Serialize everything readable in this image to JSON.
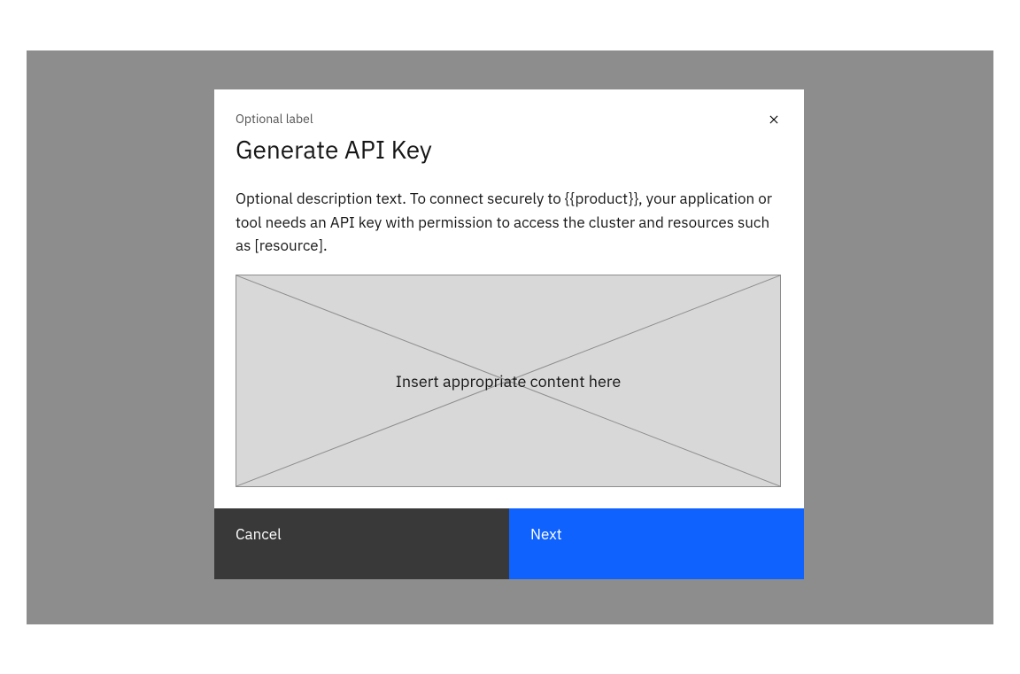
{
  "modal": {
    "optional_label": "Optional label",
    "title": "Generate API Key",
    "description": "Optional description text. To connect securely to {{product}}, your application or tool needs an API key with permission to access the cluster and resources such as [resource].",
    "placeholder_text": "Insert appropriate content here",
    "cancel_label": "Cancel",
    "next_label": "Next"
  }
}
